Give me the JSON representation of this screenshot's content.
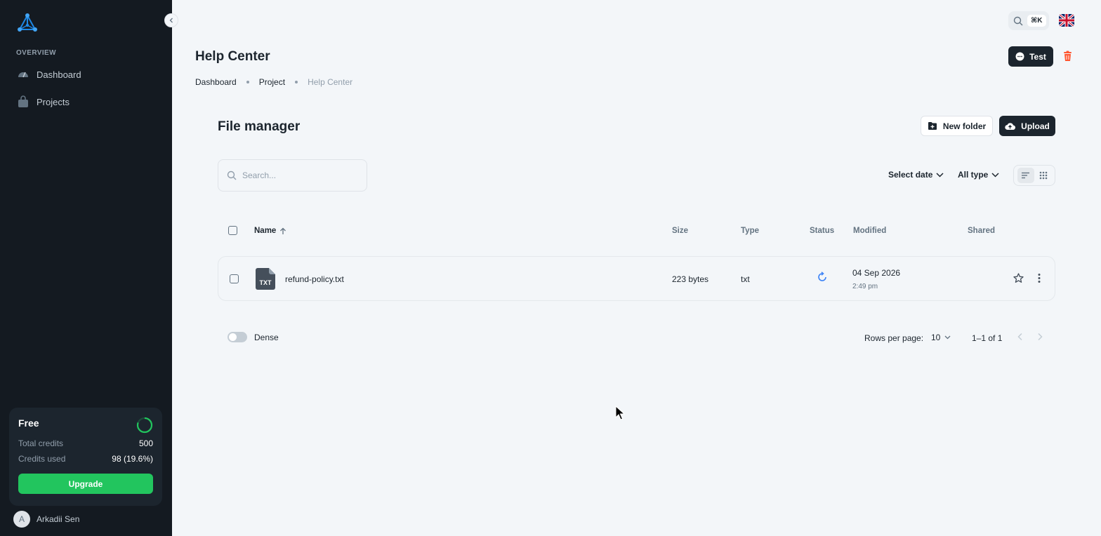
{
  "sidebar": {
    "subheader": "OVERVIEW",
    "items": [
      {
        "label": "Dashboard",
        "icon": "dashboard-icon"
      },
      {
        "label": "Projects",
        "icon": "projects-icon"
      }
    ],
    "plan": {
      "name": "Free",
      "total_credits_label": "Total credits",
      "total_credits_value": "500",
      "credits_used_label": "Credits used",
      "credits_used_value": "98 (19.6%)",
      "credits_used_fraction": 0.196,
      "upgrade_label": "Upgrade"
    },
    "user": {
      "initial": "A",
      "name": "Arkadii Sen"
    }
  },
  "topbar": {
    "shortcut": "⌘K",
    "language_flag": "uk-flag-icon"
  },
  "header": {
    "title": "Help Center",
    "breadcrumbs": [
      "Dashboard",
      "Project",
      "Help Center"
    ],
    "test_button": "Test"
  },
  "file_manager": {
    "title": "File manager",
    "new_folder_label": "New folder",
    "upload_label": "Upload",
    "search_placeholder": "Search...",
    "date_filter": "Select date",
    "type_filter": "All type",
    "columns": {
      "name": "Name",
      "size": "Size",
      "type": "Type",
      "status": "Status",
      "modified": "Modified",
      "shared": "Shared"
    },
    "rows": [
      {
        "file_badge": "TXT",
        "name": "refund-policy.txt",
        "size": "223 bytes",
        "type": "txt",
        "status_icon": "refresh-icon",
        "modified_date": "04 Sep 2026",
        "modified_time": "2:49 pm"
      }
    ],
    "dense_label": "Dense",
    "rows_per_page_label": "Rows per page:",
    "rows_per_page": "10",
    "range": "1–1 of 1"
  },
  "colors": {
    "sidebar_bg": "#141a21",
    "primary_dark": "#1c252e",
    "success": "#22c55e",
    "danger": "#ff5630",
    "accent_blue": "#3b82f6"
  }
}
